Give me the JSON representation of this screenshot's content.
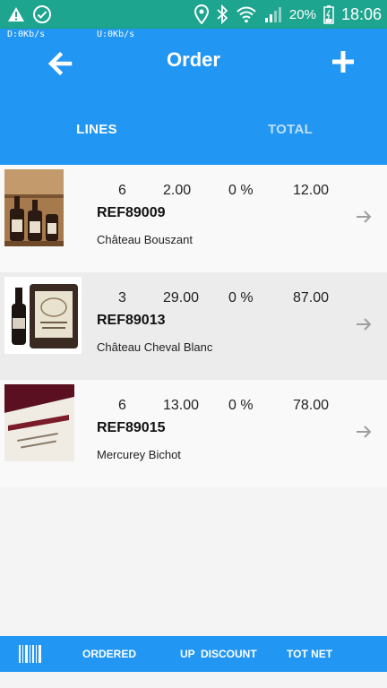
{
  "status_bar": {
    "battery_percent": "20%",
    "time": "18:06",
    "download_speed": "D:0Kb/s",
    "upload_speed": "U:0Kb/s",
    "left_icons": [
      "warning-icon",
      "check-circle-icon"
    ],
    "right_icons": [
      "location-icon",
      "bluetooth-icon",
      "wifi-icon",
      "signal-icon",
      "battery-icon"
    ]
  },
  "header": {
    "title": "Order",
    "tabs": [
      {
        "label": "LINES",
        "active": true
      },
      {
        "label": "TOTAL",
        "active": false
      }
    ]
  },
  "lines": [
    {
      "qty": "6",
      "price": "2.00",
      "discount": "0 %",
      "total": "12.00",
      "ref": "REF89009",
      "name": "Château Bouszant"
    },
    {
      "qty": "3",
      "price": "29.00",
      "discount": "0 %",
      "total": "87.00",
      "ref": "REF89013",
      "name": "Château Cheval Blanc"
    },
    {
      "qty": "6",
      "price": "13.00",
      "discount": "0 %",
      "total": "78.00",
      "ref": "REF89015",
      "name": "Mercurey Bichot"
    }
  ],
  "bottom_bar": {
    "ordered": "ORDERED",
    "up": "UP",
    "discount": "DISCOUNT",
    "tot_net": "TOT NET"
  },
  "colors": {
    "primary": "#2196f3",
    "status_bar": "#1ea58f",
    "inactive_tab": "#bfe0fb",
    "row_alt": "#ececec"
  }
}
